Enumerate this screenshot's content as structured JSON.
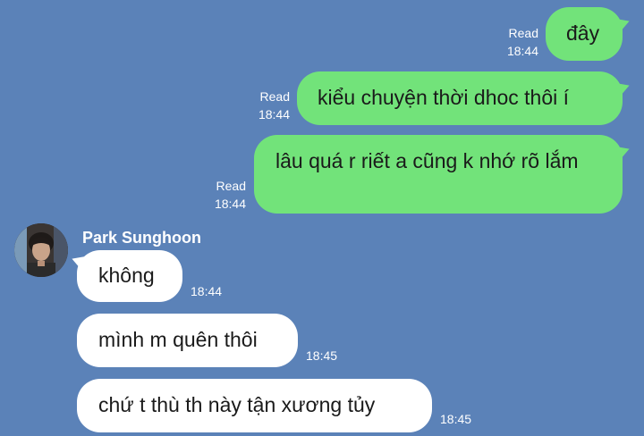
{
  "conversation": {
    "messages": [
      {
        "direction": "out",
        "text": "đây",
        "status": "Read",
        "time": "18:44"
      },
      {
        "direction": "out",
        "text": "kiểu chuyện thời dhoc thôi í",
        "status": "Read",
        "time": "18:44"
      },
      {
        "direction": "out",
        "text": "lâu quá r riết a cũng k nhớ rõ lắm",
        "status": "Read",
        "time": "18:44"
      },
      {
        "direction": "in",
        "sender": "Park Sunghoon",
        "text": "không",
        "time": "18:44"
      },
      {
        "direction": "in",
        "text": "mình m quên thôi",
        "time": "18:45"
      },
      {
        "direction": "in",
        "text": "chứ t thù th này tận xương tủy",
        "time": "18:45"
      }
    ]
  },
  "colors": {
    "background": "#5b82b8",
    "outgoing_bubble": "#72e37a",
    "incoming_bubble": "#ffffff"
  },
  "icons": {
    "avatar": "contact-avatar-photo"
  }
}
